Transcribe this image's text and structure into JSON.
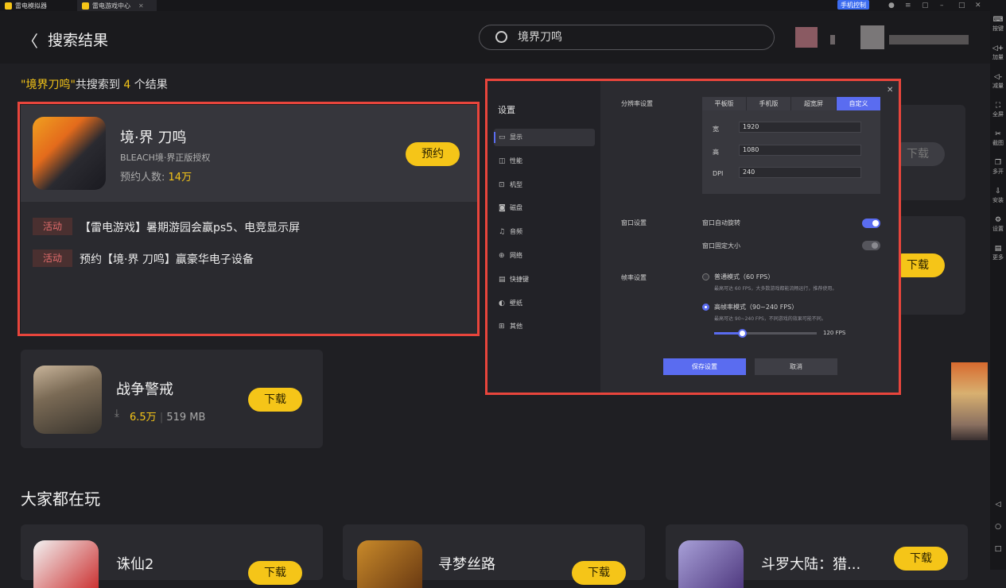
{
  "titlebar": {
    "tabs": [
      "雷电模拟器",
      "雷电游戏中心"
    ],
    "phone_control": "手机控制"
  },
  "sidebar_tools": [
    "按键",
    "加量",
    "减量",
    "全屏",
    "截图",
    "多开",
    "安装",
    "设置",
    "更多"
  ],
  "header": {
    "title": "搜索结果",
    "search_value": "境界刀鸣"
  },
  "result_line": {
    "query": "\"境界刀鸣\"",
    "middle": "共搜索到",
    "count": "4",
    "suffix": "个结果"
  },
  "game1": {
    "name": "境·界 刀鸣",
    "subtitle": "BLEACH境·界正版授权",
    "stat_label": "预约人数:",
    "stat_value": "14万",
    "button": "预约",
    "activities": [
      {
        "badge": "活动",
        "text": "【雷电游戏】暑期游园会赢ps5、电竞显示屏"
      },
      {
        "badge": "活动",
        "text": "预约【境·界 刀鸣】赢豪华电子设备"
      }
    ]
  },
  "game2": {
    "name": "战争警戒",
    "downloads": "6.5万",
    "size": "519 MB",
    "button": "下载"
  },
  "side_buttons": [
    "下载",
    "下载"
  ],
  "section_title": "大家都在玩",
  "popular": [
    {
      "name": "诛仙2",
      "button": "下载"
    },
    {
      "name": "寻梦丝路",
      "button": "下载"
    },
    {
      "name": "斗罗大陆：猎...",
      "button": "下载"
    }
  ],
  "settings": {
    "title": "设置",
    "menu": [
      {
        "icon": "▭",
        "label": "显示"
      },
      {
        "icon": "◫",
        "label": "性能"
      },
      {
        "icon": "⊡",
        "label": "机型"
      },
      {
        "icon": "◙",
        "label": "磁盘"
      },
      {
        "icon": "♫",
        "label": "音频"
      },
      {
        "icon": "⊕",
        "label": "网络"
      },
      {
        "icon": "▤",
        "label": "快捷键"
      },
      {
        "icon": "◐",
        "label": "壁纸"
      },
      {
        "icon": "⊞",
        "label": "其他"
      }
    ],
    "resolution_label": "分辨率设置",
    "res_tabs": [
      "平板版",
      "手机版",
      "超宽屏",
      "自定义"
    ],
    "width_label": "宽",
    "width_value": "1920",
    "height_label": "高",
    "height_value": "1080",
    "dpi_label": "DPI",
    "dpi_value": "240",
    "window_label": "窗口设置",
    "auto_rotate": "窗口自动旋转",
    "auto_rotate_on": true,
    "fixed_size": "窗口固定大小",
    "fixed_size_on": false,
    "fps_label": "帧率设置",
    "normal_mode": "普通模式（60 FPS）",
    "normal_desc": "最高可达 60 FPS，大多数游戏都能流畅运行，推荐使用。",
    "high_mode": "高帧率模式（90~240 FPS）",
    "high_desc": "最高可达 90~240 FPS，不同游戏的效果可能不同。",
    "fps_value": "120 FPS",
    "save": "保存设置",
    "cancel": "取消",
    "accent": "#5a6cf0"
  },
  "colors": {
    "brand_yellow": "#f5c518",
    "highlight_red": "#e8453c"
  }
}
